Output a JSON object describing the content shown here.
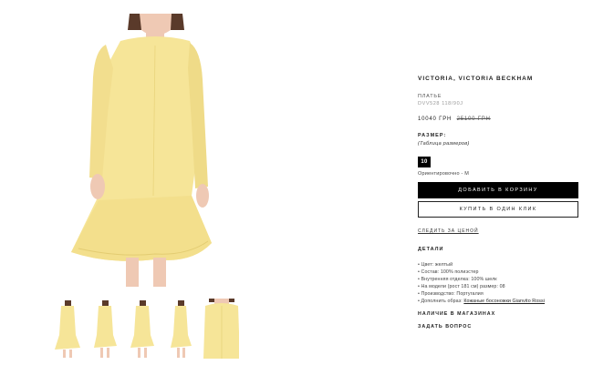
{
  "product": {
    "brand": "VICTORIA, VICTORIA BECKHAM",
    "type": "ПЛАТЬЕ",
    "sku": "DVV528 118/90J",
    "price": "10040 ГРН",
    "old_price": "25100 ГРН"
  },
  "size": {
    "title": "РАЗМЕР:",
    "table_link": "(Таблица размеров)",
    "selected": "10",
    "note": "Ориентировочно - M"
  },
  "actions": {
    "add_to_cart": "ДОБАВИТЬ В КОРЗИНУ",
    "one_click": "КУПИТЬ В ОДИН КЛИК",
    "track_price": "СЛЕДИТЬ ЗА ЦЕНОЙ"
  },
  "details": {
    "title": "ДЕТАЛИ",
    "items": [
      "Цвет: желтый",
      "Состав: 100% полиэстер",
      "Внутренняя отделка: 100% шелк",
      "На модели (рост 181 см) размер: 08",
      "Производство: Португалия"
    ],
    "complement_label": "Дополнить образ:",
    "complement_link": "Кожаные босоножки Gianvito Rossi"
  },
  "sections": {
    "stores": "НАЛИЧИЕ В МАГАЗИНАХ",
    "ask": "ЗАДАТЬ ВОПРОС"
  },
  "colors": {
    "dress": "#f6e598",
    "dress_shade": "#e9d47c",
    "skin": "#efc9b4",
    "hair": "#5a3a2a",
    "accent": "#000000"
  }
}
